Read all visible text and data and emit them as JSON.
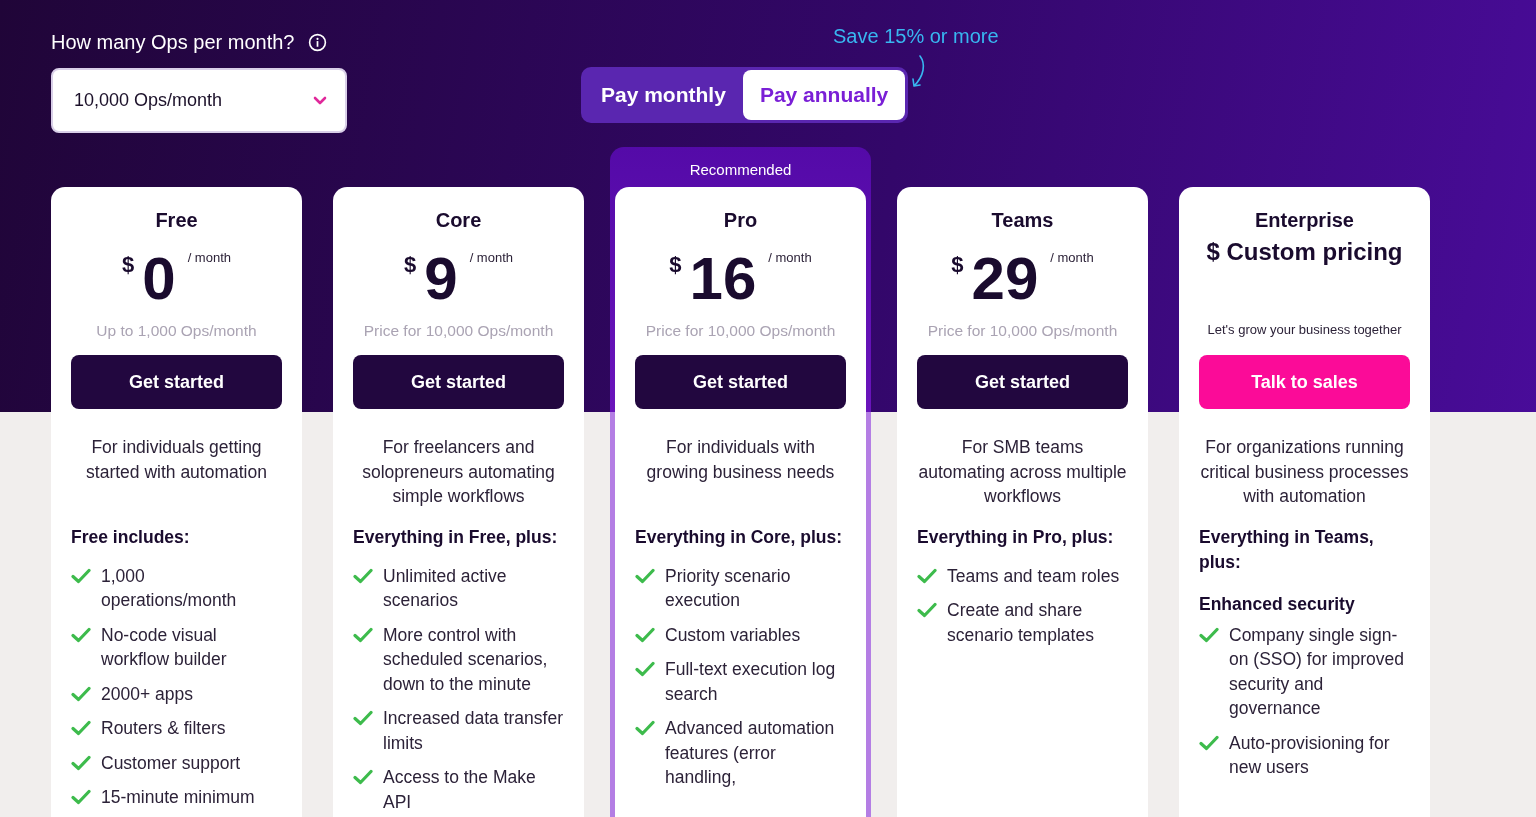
{
  "ops_question": {
    "label": "How many Ops per month?"
  },
  "ops_select": {
    "value": "10,000 Ops/month"
  },
  "billing": {
    "savings_note": "Save 15% or more",
    "tabs": [
      {
        "label": "Pay monthly",
        "selected": false
      },
      {
        "label": "Pay annually",
        "selected": true
      }
    ]
  },
  "plans": [
    {
      "name": "Free",
      "kind": "amount",
      "currency": "$",
      "price": "0",
      "period": "/ month",
      "price_note": "Up to 1,000 Ops/month",
      "button": {
        "label": "Get started",
        "kind": "dark"
      },
      "description": "For individuals getting started with automation",
      "includes_title": "Free includes:",
      "features": [
        {
          "kind": "feature",
          "text": "1,000 operations/month"
        },
        {
          "kind": "feature",
          "text": "No-code visual workflow builder"
        },
        {
          "kind": "feature",
          "text": "2000+ apps"
        },
        {
          "kind": "feature",
          "text": "Routers & filters"
        },
        {
          "kind": "feature",
          "text": "Customer support"
        },
        {
          "kind": "feature",
          "text": "15-minute minimum"
        }
      ]
    },
    {
      "name": "Core",
      "kind": "amount",
      "currency": "$",
      "price": "9",
      "period": "/ month",
      "price_note": "Price for 10,000 Ops/month",
      "button": {
        "label": "Get started",
        "kind": "dark"
      },
      "description": "For freelancers and solopreneurs automating simple workflows",
      "includes_title": "Everything in Free, plus:",
      "features": [
        {
          "kind": "feature",
          "text": "Unlimited active scenarios"
        },
        {
          "kind": "feature",
          "text": "More control with scheduled scenarios, down to the minute"
        },
        {
          "kind": "feature",
          "text": "Increased data transfer limits"
        },
        {
          "kind": "feature",
          "text": "Access to the Make API"
        }
      ]
    },
    {
      "name": "Pro",
      "badge": "Recommended",
      "kind": "amount",
      "currency": "$",
      "price": "16",
      "period": "/ month",
      "price_note": "Price for 10,000 Ops/month",
      "button": {
        "label": "Get started",
        "kind": "dark"
      },
      "description": "For individuals with growing business needs",
      "includes_title": "Everything in Core, plus:",
      "features": [
        {
          "kind": "feature",
          "text": "Priority scenario execution"
        },
        {
          "kind": "feature",
          "text": "Custom variables"
        },
        {
          "kind": "feature",
          "text": "Full-text execution log search"
        },
        {
          "kind": "feature",
          "text": "Advanced automation features (error handling,"
        }
      ]
    },
    {
      "name": "Teams",
      "kind": "amount",
      "currency": "$",
      "price": "29",
      "period": "/ month",
      "price_note": "Price for 10,000 Ops/month",
      "button": {
        "label": "Get started",
        "kind": "dark"
      },
      "description": "For SMB teams automating across multiple workflows",
      "includes_title": "Everything in Pro, plus:",
      "features": [
        {
          "kind": "feature",
          "text": "Teams and team roles"
        },
        {
          "kind": "feature",
          "text": "Create and share scenario templates"
        }
      ]
    },
    {
      "name": "Enterprise",
      "kind": "custom",
      "price": "$ Custom pricing",
      "price_note": "Let's grow your business together",
      "button": {
        "label": "Talk to sales",
        "kind": "pink"
      },
      "description": "For organizations running critical business processes with automation",
      "includes_title": "Everything in Teams, plus:",
      "features": [
        {
          "kind": "subheading",
          "text": "Enhanced security"
        },
        {
          "kind": "feature",
          "text": "Company single sign-on (SSO) for improved security and governance"
        },
        {
          "kind": "feature",
          "text": "Auto-provisioning for new users"
        }
      ]
    }
  ]
}
